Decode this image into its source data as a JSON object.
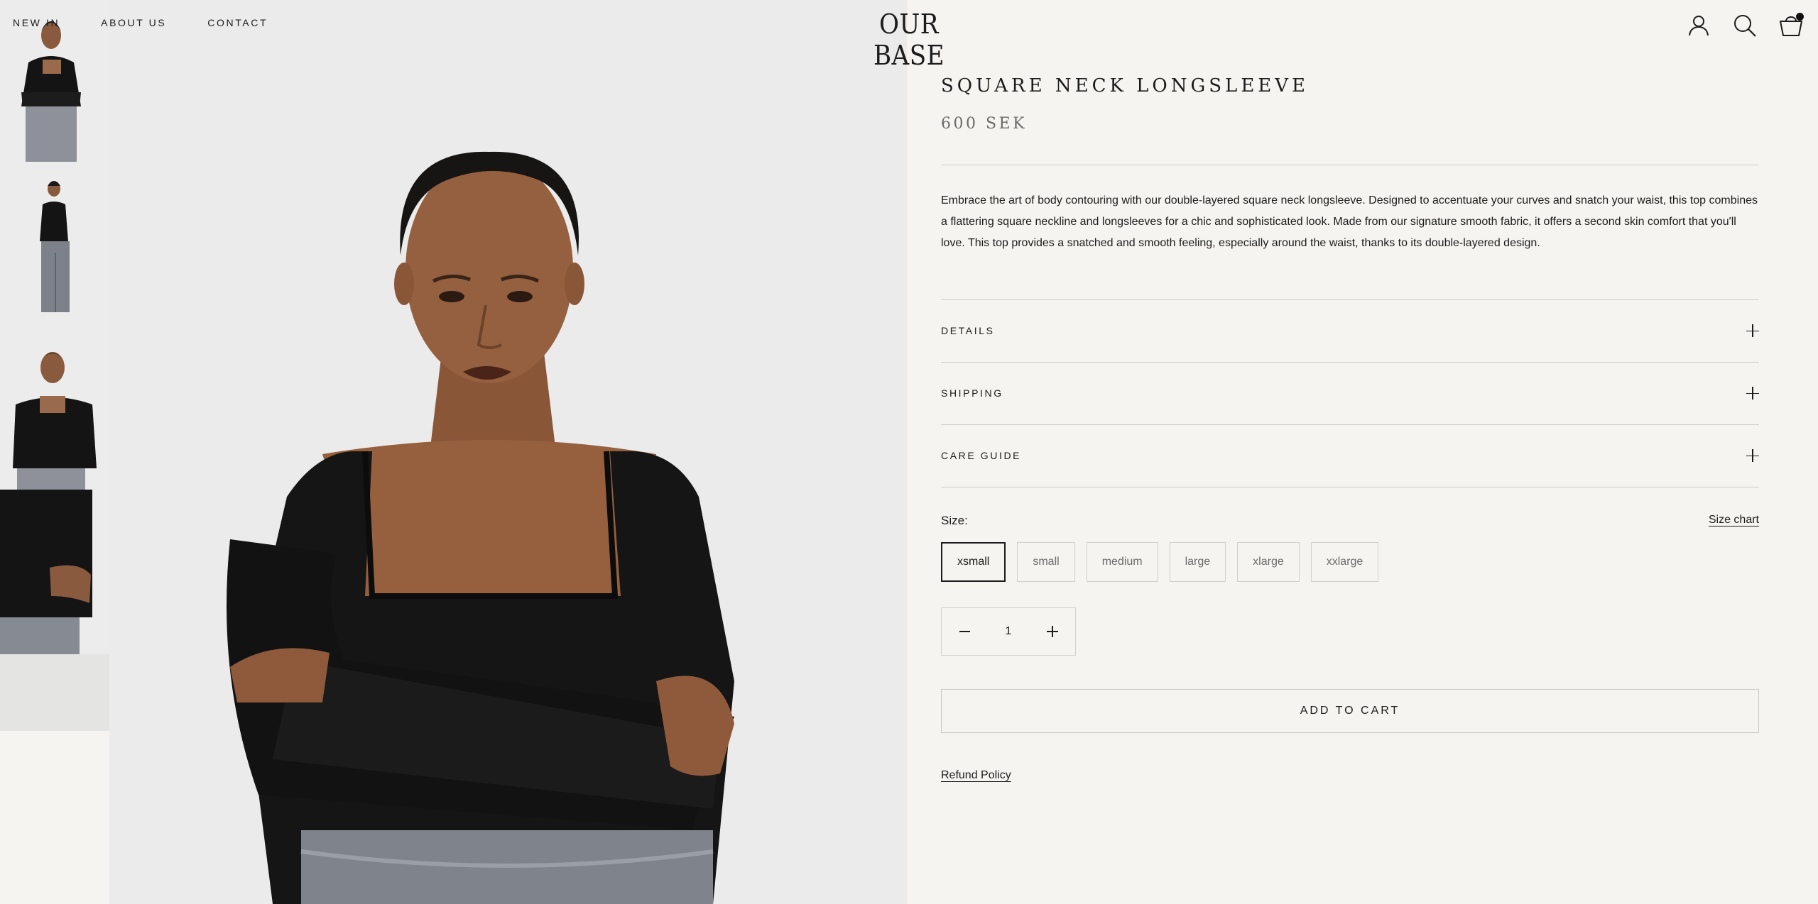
{
  "nav": {
    "items": [
      {
        "label": "NEW IN"
      },
      {
        "label": "ABOUT US"
      },
      {
        "label": "CONTACT"
      }
    ]
  },
  "brand": {
    "logo_text": "OUR BASE"
  },
  "header_icons": [
    "account-icon",
    "search-icon",
    "cart-icon"
  ],
  "product": {
    "title": "SQUARE NECK LONGSLEEVE",
    "price": "600 SEK",
    "description": "Embrace the art of body contouring with our double-layered square neck longsleeve. Designed to accentuate your curves and snatch your waist, this top combines a flattering square neckline and longsleeves for a chic and sophisticated look. Made from our signature smooth fabric, it offers a second skin comfort that you'll love. This top provides a snatched and smooth feeling, especially around the waist, thanks to its double-layered design."
  },
  "accordion": [
    {
      "label": "DETAILS"
    },
    {
      "label": "SHIPPING"
    },
    {
      "label": "CARE GUIDE"
    }
  ],
  "size": {
    "label": "Size:",
    "chart_link": "Size chart",
    "options": [
      "xsmall",
      "small",
      "medium",
      "large",
      "xlarge",
      "xxlarge"
    ],
    "selected": "xsmall"
  },
  "quantity": {
    "value": "1"
  },
  "cart": {
    "add_label": "ADD TO CART"
  },
  "policy": {
    "refund_label": "Refund Policy"
  },
  "colors": {
    "background": "#f5f4f0",
    "image_bg": "#ebebeb",
    "text": "#1c1c1c",
    "muted": "#6b6b6b",
    "border": "#d2d0cb"
  }
}
